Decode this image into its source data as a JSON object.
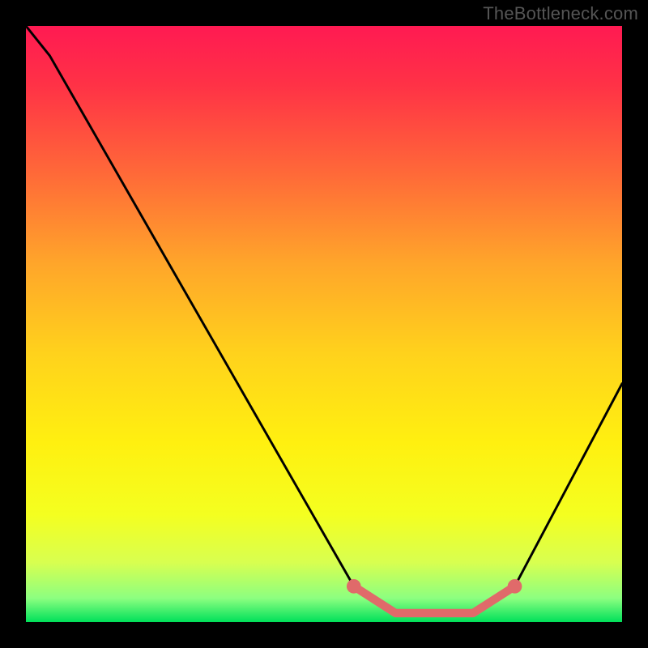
{
  "watermark": "TheBottleneck.com",
  "chart_data": {
    "type": "line",
    "title": "",
    "xlabel": "",
    "ylabel": "",
    "xlim": [
      0,
      1
    ],
    "ylim": [
      0,
      1
    ],
    "gradient_stops": [
      {
        "offset": 0.0,
        "color": "#ff1a52"
      },
      {
        "offset": 0.1,
        "color": "#ff3246"
      },
      {
        "offset": 0.25,
        "color": "#ff6a38"
      },
      {
        "offset": 0.4,
        "color": "#ffa62a"
      },
      {
        "offset": 0.55,
        "color": "#ffd21c"
      },
      {
        "offset": 0.7,
        "color": "#fff010"
      },
      {
        "offset": 0.82,
        "color": "#f4ff20"
      },
      {
        "offset": 0.9,
        "color": "#d8ff50"
      },
      {
        "offset": 0.96,
        "color": "#8cff80"
      },
      {
        "offset": 1.0,
        "color": "#00e05a"
      }
    ],
    "series": [
      {
        "name": "bottleneck-curve",
        "x": [
          0.0,
          0.04,
          0.55,
          0.62,
          0.75,
          0.82,
          1.0
        ],
        "y": [
          1.0,
          0.95,
          0.06,
          0.015,
          0.015,
          0.06,
          0.4
        ]
      }
    ],
    "optimal_segment": {
      "x": [
        0.55,
        0.62,
        0.75,
        0.82
      ],
      "y": [
        0.06,
        0.015,
        0.015,
        0.06
      ],
      "endpoint_radius": 0.012,
      "color": "#e06a6a"
    }
  }
}
